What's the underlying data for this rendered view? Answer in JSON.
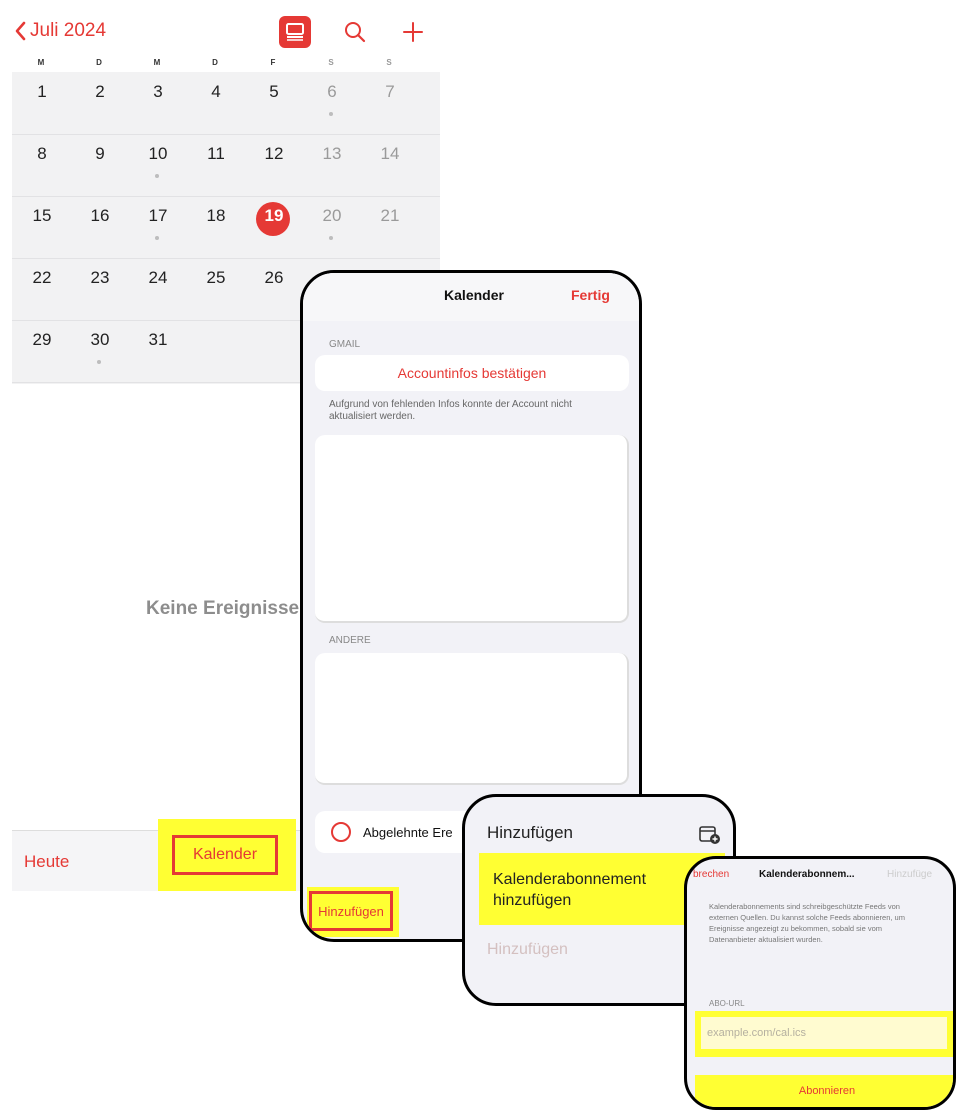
{
  "calendar": {
    "month_label": "Juli 2024",
    "weekdays": [
      "M",
      "D",
      "M",
      "D",
      "F",
      "S",
      "S"
    ],
    "weeks": [
      [
        "1",
        "2",
        "3",
        "4",
        "5",
        "6",
        "7"
      ],
      [
        "8",
        "9",
        "10",
        "11",
        "12",
        "13",
        "14"
      ],
      [
        "15",
        "16",
        "17",
        "18",
        "19",
        "20",
        "21"
      ],
      [
        "22",
        "23",
        "24",
        "25",
        "26",
        "",
        ""
      ],
      [
        "29",
        "30",
        "31",
        "",
        "",
        "",
        ""
      ]
    ],
    "today": "19",
    "no_events": "Keine Ereignisse",
    "tabbar": {
      "today_label": "Heute",
      "calendars_label": "Kalender"
    }
  },
  "calendars_sheet": {
    "title": "Kalender",
    "done_label": "Fertig",
    "section_gmail": "GMAIL",
    "account_action": "Accountinfos bestätigen",
    "account_note": "Aufgrund von fehlenden Infos konnte der Account nicht aktualisiert werden.",
    "section_other": "ANDERE",
    "rejected_label": "Abgelehnte Ere",
    "add_label": "Hinzufügen"
  },
  "add_menu": {
    "title": "Hinzufügen",
    "subscription_label": "Kalenderabonnement hinzufügen",
    "disabled_label": "Hinzufügen"
  },
  "subscription_sheet": {
    "cancel_label": "brechen",
    "title": "Kalenderabonnem...",
    "add_label": "Hinzufüge",
    "description": "Kalenderabonnements sind schreibgeschützte Feeds von externen Quellen. Du kannst solche Feeds abonnieren, um Ereignisse angezeigt zu bekommen, sobald sie vom Datenanbieter aktualisiert wurden.",
    "url_label": "ABO-URL",
    "url_placeholder": "example.com/cal.ics",
    "subscribe_label": "Abonnieren"
  },
  "colors": {
    "accent": "#e53935",
    "highlight": "#ffff33"
  },
  "icons": [
    "chevron-left-icon",
    "calendar-view-icon",
    "search-icon",
    "plus-icon",
    "calendar-add-icon"
  ]
}
